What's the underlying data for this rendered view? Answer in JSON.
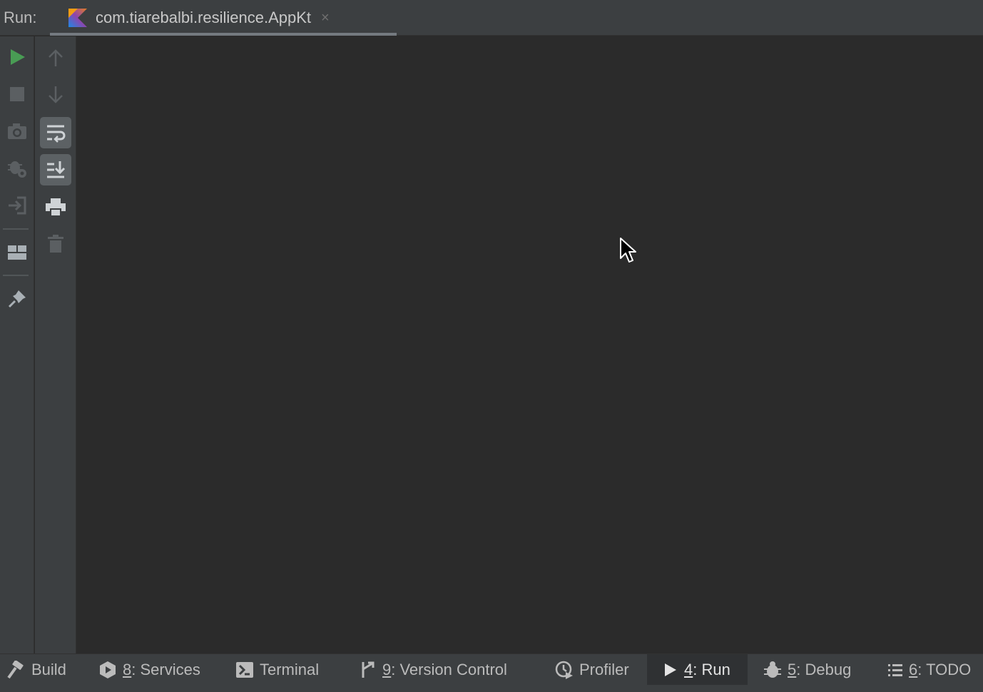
{
  "header": {
    "run_label": "Run:",
    "tab": {
      "title": "com.tiarebalbi.resilience.AppKt",
      "close": "×",
      "icon": "kotlin-icon"
    }
  },
  "left_toolbar": [
    {
      "name": "rerun",
      "icon": "play-icon",
      "color": "#499c54"
    },
    {
      "name": "stop",
      "icon": "stop-icon"
    },
    {
      "name": "dump-threads",
      "icon": "camera-icon"
    },
    {
      "name": "exception-breakpoints",
      "icon": "bug-gear-icon"
    },
    {
      "name": "exit",
      "icon": "exit-icon"
    },
    {
      "name": "restore-layout",
      "icon": "layout-icon"
    },
    {
      "name": "pin-tab",
      "icon": "pin-icon"
    }
  ],
  "console_toolbar": [
    {
      "name": "previous-occurrence",
      "icon": "arrow-up-icon"
    },
    {
      "name": "next-occurrence",
      "icon": "arrow-down-icon"
    },
    {
      "name": "soft-wrap",
      "icon": "soft-wrap-icon",
      "active": true
    },
    {
      "name": "scroll-to-end",
      "icon": "scroll-to-end-icon",
      "active": true
    },
    {
      "name": "print",
      "icon": "print-icon"
    },
    {
      "name": "clear-all",
      "icon": "trash-icon"
    }
  ],
  "console": {
    "output": ""
  },
  "bottom_bar": {
    "build": {
      "label": "Build"
    },
    "services": {
      "num": "8",
      "label": ": Services"
    },
    "terminal": {
      "label": "Terminal"
    },
    "vcs": {
      "num": "9",
      "label": ": Version Control"
    },
    "profiler": {
      "label": "Profiler"
    },
    "run": {
      "num": "4",
      "label": ": Run",
      "active": true
    },
    "debug": {
      "num": "5",
      "label": ": Debug"
    },
    "todo": {
      "num": "6",
      "label": ": TODO"
    }
  }
}
